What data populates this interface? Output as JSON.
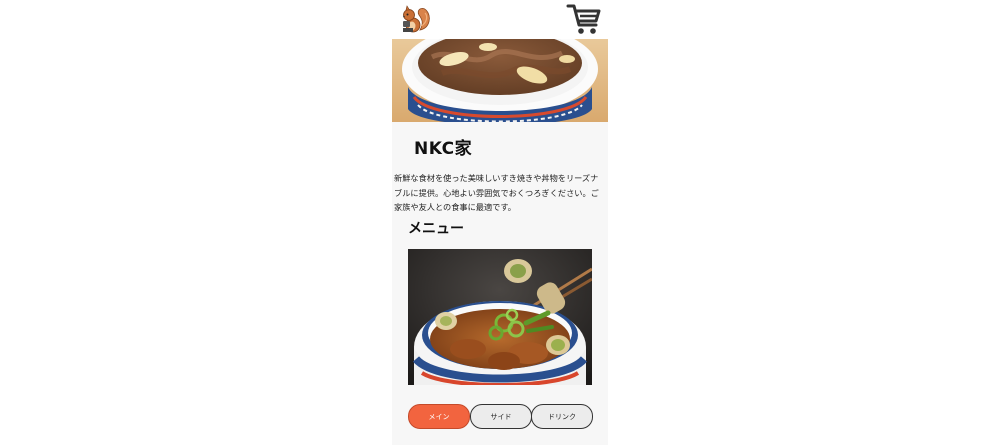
{
  "header": {
    "logo_icon": "squirrel-icon",
    "cart_icon": "cart-icon"
  },
  "restaurant": {
    "name": "NKC家",
    "description": "新鮮な食材を使った美味しいすき焼きや丼物をリーズナブルに提供。心地よい雰囲気でおくつろぎください。ご家族や友人との食事に最適です。"
  },
  "menu": {
    "heading": "メニュー",
    "tabs": [
      {
        "label": "メイン",
        "active": true
      },
      {
        "label": "サイド",
        "active": false
      },
      {
        "label": "ドリンク",
        "active": false
      }
    ]
  },
  "colors": {
    "accent": "#f2643f",
    "tab_bg": "#ececec",
    "panel_bg": "#f7f7f7"
  }
}
